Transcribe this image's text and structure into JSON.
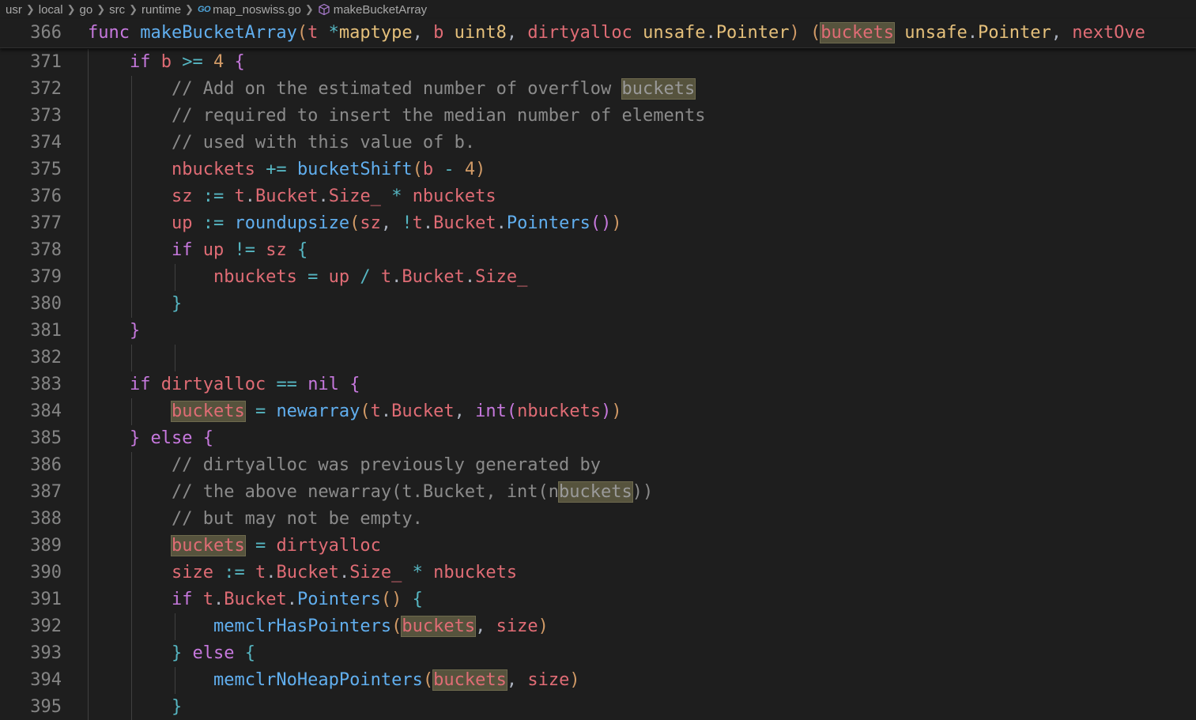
{
  "breadcrumb": {
    "items": [
      "usr",
      "local",
      "go",
      "src",
      "runtime",
      "map_noswiss.go",
      "makeBucketArray"
    ],
    "file_icon": "go-file-icon",
    "symbol_icon": "cube-icon",
    "go_badge": "GO"
  },
  "editor": {
    "highlight_word": "buckets",
    "sticky_line": {
      "number": "366",
      "text": "func makeBucketArray(t *maptype, b uint8, dirtyalloc unsafe.Pointer) (buckets unsafe.Pointer, nextOve"
    },
    "lines": [
      {
        "number": "371",
        "text": "    if b >= 4 {"
      },
      {
        "number": "372",
        "text": "        // Add on the estimated number of overflow buckets"
      },
      {
        "number": "373",
        "text": "        // required to insert the median number of elements"
      },
      {
        "number": "374",
        "text": "        // used with this value of b."
      },
      {
        "number": "375",
        "text": "        nbuckets += bucketShift(b - 4)"
      },
      {
        "number": "376",
        "text": "        sz := t.Bucket.Size_ * nbuckets"
      },
      {
        "number": "377",
        "text": "        up := roundupsize(sz, !t.Bucket.Pointers())"
      },
      {
        "number": "378",
        "text": "        if up != sz {"
      },
      {
        "number": "379",
        "text": "            nbuckets = up / t.Bucket.Size_"
      },
      {
        "number": "380",
        "text": "        }"
      },
      {
        "number": "381",
        "text": "    }"
      },
      {
        "number": "382",
        "text": ""
      },
      {
        "number": "383",
        "text": "    if dirtyalloc == nil {"
      },
      {
        "number": "384",
        "text": "        buckets = newarray(t.Bucket, int(nbuckets))"
      },
      {
        "number": "385",
        "text": "    } else {"
      },
      {
        "number": "386",
        "text": "        // dirtyalloc was previously generated by"
      },
      {
        "number": "387",
        "text": "        // the above newarray(t.Bucket, int(nbuckets))"
      },
      {
        "number": "388",
        "text": "        // but may not be empty."
      },
      {
        "number": "389",
        "text": "        buckets = dirtyalloc"
      },
      {
        "number": "390",
        "text": "        size := t.Bucket.Size_ * nbuckets"
      },
      {
        "number": "391",
        "text": "        if t.Bucket.Pointers() {"
      },
      {
        "number": "392",
        "text": "            memclrHasPointers(buckets, size)"
      },
      {
        "number": "393",
        "text": "        } else {"
      },
      {
        "number": "394",
        "text": "            memclrNoHeapPointers(buckets, size)"
      },
      {
        "number": "395",
        "text": "        }"
      }
    ]
  },
  "colors": {
    "background": "#1e1e1e",
    "keyword": "#c678dd",
    "function": "#61afef",
    "identifier": "#e06c75",
    "type": "#e5c07b",
    "number": "#d19a66",
    "operator": "#56b6c2",
    "comment": "#8b8b8b",
    "highlight": "#56533d"
  }
}
